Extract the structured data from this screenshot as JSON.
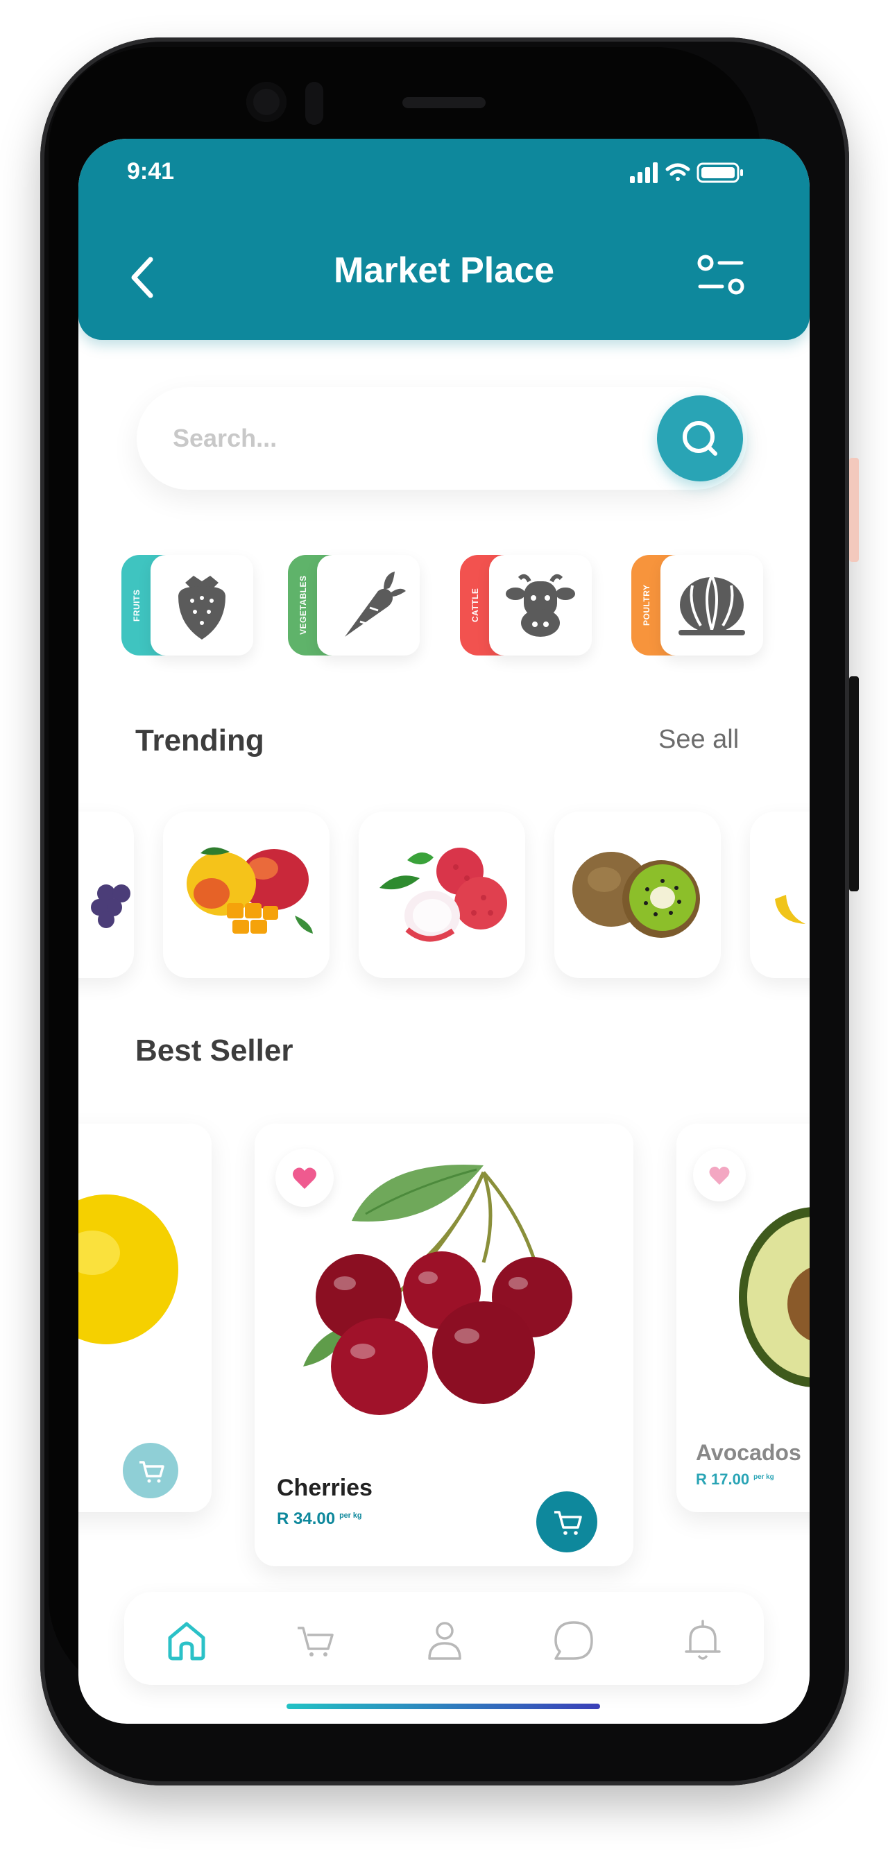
{
  "status": {
    "time": "9:41"
  },
  "header": {
    "title": "Market Place"
  },
  "search": {
    "placeholder": "Search..."
  },
  "categories": [
    {
      "label": "FRUITS",
      "color": "#3fc4c0",
      "icon": "strawberry-icon"
    },
    {
      "label": "VEGETABLES",
      "color": "#5fb36a",
      "icon": "carrot-icon"
    },
    {
      "label": "CATTLE",
      "color": "#f2524f",
      "icon": "cow-icon"
    },
    {
      "label": "POULTRY",
      "color": "#f7943c",
      "icon": "poultry-icon"
    }
  ],
  "trending": {
    "title": "Trending",
    "see_all": "See all",
    "items": [
      "grapes",
      "mangoes",
      "lychees",
      "kiwis",
      "bananas"
    ]
  },
  "best_seller": {
    "title": "Best Seller",
    "items": [
      {
        "name": "",
        "price": "",
        "unit": "",
        "image": "lemon"
      },
      {
        "name": "Cherries",
        "price": "R 34.00",
        "unit": "per kg",
        "image": "cherries"
      },
      {
        "name": "Avocados",
        "price": "R 17.00",
        "unit": "per kg",
        "image": "avocado"
      }
    ]
  },
  "nav": {
    "items": [
      "home-icon",
      "cart-icon",
      "profile-icon",
      "chat-icon",
      "bell-icon"
    ],
    "active": "home-icon"
  },
  "colors": {
    "primary": "#0e889c",
    "accent": "#29a4b5",
    "favorite": "#ef5a8f"
  }
}
